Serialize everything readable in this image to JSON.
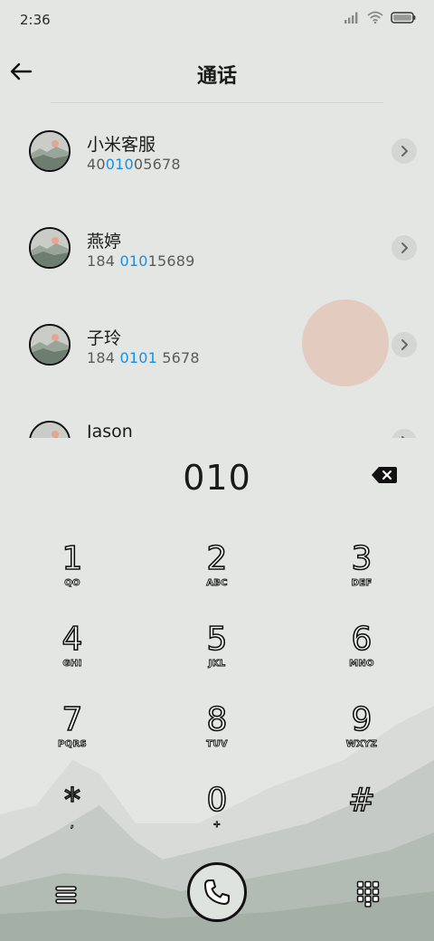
{
  "status_bar": {
    "time": "2:36",
    "icons": [
      "signal-icon",
      "wifi-icon",
      "battery-icon"
    ]
  },
  "header": {
    "title": "通话",
    "back_icon": "arrow-left-icon"
  },
  "results": [
    {
      "name": "小米客服",
      "number_prefix": "40",
      "number_match": "010",
      "number_suffix": "05678"
    },
    {
      "name": "燕婷",
      "number_prefix": "184 ",
      "number_match": "010",
      "number_suffix": "15689"
    },
    {
      "name": "子玲",
      "number_prefix": "184 ",
      "number_match": "0101",
      "number_suffix": " 5678"
    },
    {
      "name": "Jason",
      "number_prefix": "",
      "number_match": "",
      "number_suffix": ""
    }
  ],
  "dial": {
    "input_value": "010",
    "backspace_icon": "backspace-icon"
  },
  "keypad": [
    {
      "digit": "1",
      "letters": "QO"
    },
    {
      "digit": "2",
      "letters": "ABC"
    },
    {
      "digit": "3",
      "letters": "DEF"
    },
    {
      "digit": "4",
      "letters": "GHI"
    },
    {
      "digit": "5",
      "letters": "JKL"
    },
    {
      "digit": "6",
      "letters": "MNO"
    },
    {
      "digit": "7",
      "letters": "PQRS"
    },
    {
      "digit": "8",
      "letters": "TUV"
    },
    {
      "digit": "9",
      "letters": "WXYZ"
    },
    {
      "digit": "*",
      "letters": ","
    },
    {
      "digit": "0",
      "letters": "+"
    },
    {
      "digit": "#",
      "letters": ""
    }
  ],
  "bottom_bar": {
    "left_icon": "menu-icon",
    "center_icon": "phone-icon",
    "right_icon": "dialpad-icon"
  },
  "colors": {
    "background": "#e3e6e3",
    "highlight": "#1a8fe0",
    "ripple": "#e3cbbf"
  }
}
